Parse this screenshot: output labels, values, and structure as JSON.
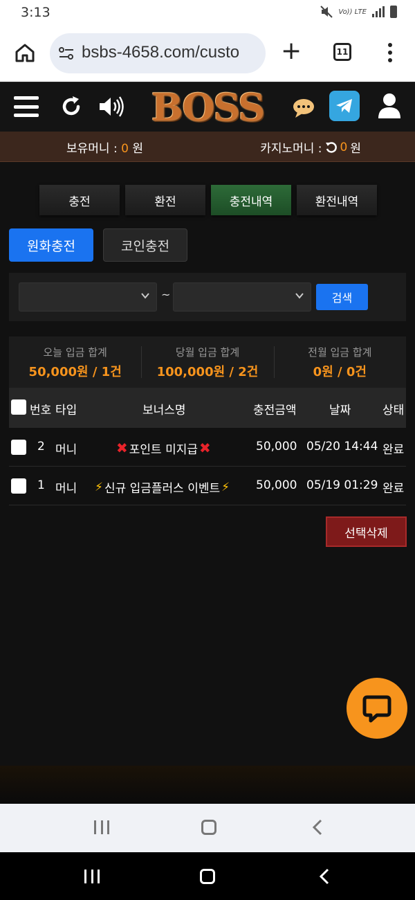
{
  "status_bar": {
    "time": "3:13",
    "volte": "Vo)) LTE",
    "lte": "LTE"
  },
  "browser": {
    "url": "bsbs-4658.com/custo",
    "tab_count": "11"
  },
  "header": {
    "logo_text": "BOSS"
  },
  "balance": {
    "holding_label": "보유머니 : ",
    "holding_value": "0",
    "holding_unit": " 원",
    "casino_label": "카지노머니 : ",
    "casino_value": "0",
    "casino_unit": " 원"
  },
  "tabs": [
    {
      "label": "충전",
      "active": false
    },
    {
      "label": "환전",
      "active": false
    },
    {
      "label": "충전내역",
      "active": true
    },
    {
      "label": "환전내역",
      "active": false
    }
  ],
  "subtabs": {
    "fiat": "원화충전",
    "coin": "코인충전"
  },
  "search": {
    "tilde": "~",
    "button": "검색"
  },
  "totals": [
    {
      "label": "오늘 입금 합계",
      "value": "50,000원 / 1건"
    },
    {
      "label": "당월 입금 합계",
      "value": "100,000원 / 2건"
    },
    {
      "label": "전월 입금 합계",
      "value": "0원 / 0건"
    }
  ],
  "table": {
    "headers": {
      "no": "번호",
      "type": "타입",
      "bonus": "보너스명",
      "amount": "충전금액",
      "date": "날짜",
      "status": "상태"
    },
    "rows": [
      {
        "no": "2",
        "type": "머니",
        "bonus": "포인트 미지급",
        "amount": "50,000",
        "date": "05/20 14:44",
        "status": "완료",
        "bonus_icon": "red-x-icon"
      },
      {
        "no": "1",
        "type": "머니",
        "bonus": "신규 입금플러스 이벤트",
        "amount": "50,000",
        "date": "05/19 01:29",
        "status": "완료",
        "bonus_icon": "lightning-icon"
      }
    ]
  },
  "delete_button": "선택삭제",
  "colors": {
    "accent_orange": "#f7941d",
    "primary_blue": "#1a73f0",
    "active_tab_green": "#2d6b38",
    "delete_red": "#7e1a1a"
  }
}
